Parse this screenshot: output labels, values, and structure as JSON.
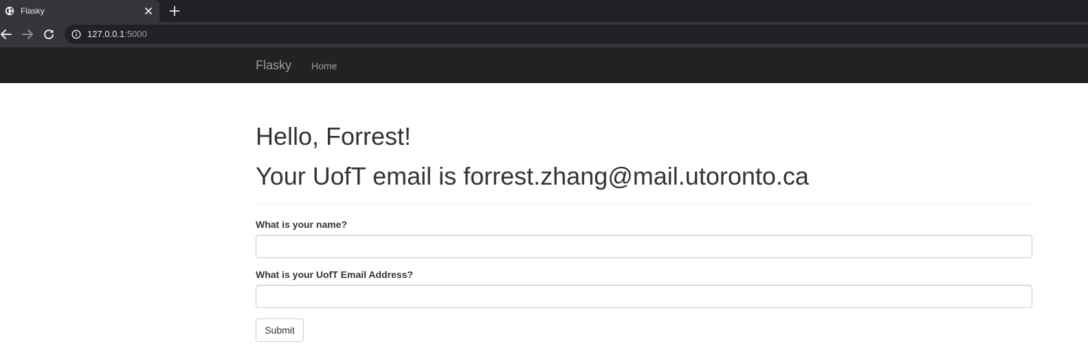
{
  "browser": {
    "tab": {
      "title": "Flasky",
      "favicon": "globe-icon"
    },
    "address": {
      "host": "127.0.0.1",
      "port": ":5000"
    },
    "icons": {
      "back": "arrow-left-icon",
      "forward": "arrow-right-icon",
      "reload": "reload-icon",
      "site_info": "info-icon",
      "close_tab": "close-icon",
      "new_tab": "plus-icon"
    }
  },
  "navbar": {
    "brand": "Flasky",
    "links": [
      {
        "label": "Home"
      }
    ]
  },
  "main": {
    "greeting": "Hello, Forrest!",
    "email_message": "Your UofT email is forrest.zhang@mail.utoronto.ca",
    "form": {
      "name_label": "What is your name?",
      "name_value": "",
      "email_label": "What is your UofT Email Address?",
      "email_value": "",
      "submit_label": "Submit"
    }
  },
  "colors": {
    "browser_tabstrip": "#202124",
    "browser_toolbar": "#35363a",
    "navbar_bg": "#222222",
    "navbar_text": "#9d9d9d",
    "heading_text": "#333333",
    "input_border": "#cccccc"
  }
}
